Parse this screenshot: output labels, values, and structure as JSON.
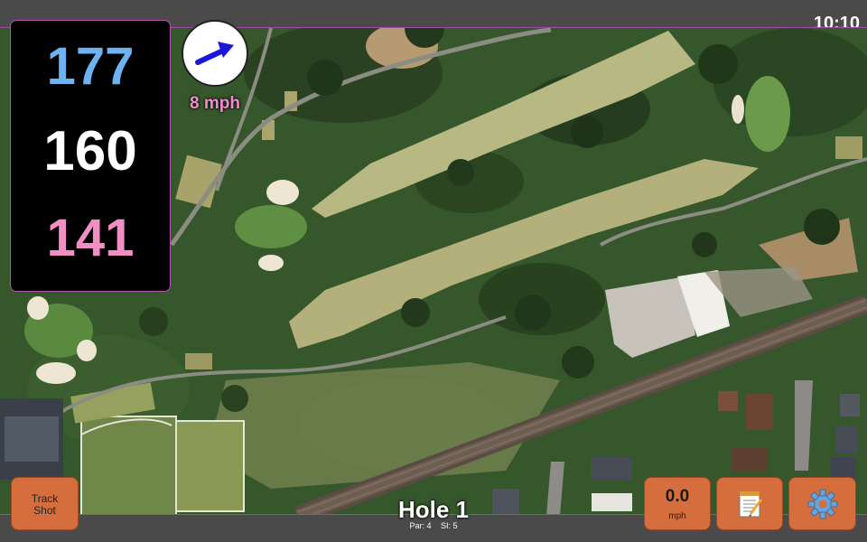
{
  "status": {
    "time": "10:10"
  },
  "distances": {
    "back": "177",
    "middle": "160",
    "front": "141"
  },
  "wind": {
    "speed": "8 mph",
    "direction_icon": "arrow-right-icon"
  },
  "hole": {
    "title": "Hole 1",
    "par": "Par: 4",
    "stroke_index": "SI: 5"
  },
  "buttons": {
    "track_shot_line1": "Track",
    "track_shot_line2": "Shot",
    "speed_value": "0.0",
    "speed_unit": "mph",
    "notes_icon": "notepad-icon",
    "settings_icon": "gear-icon"
  },
  "colors": {
    "back_distance": "#6eb2f2",
    "middle_distance": "#ffffff",
    "front_distance": "#f18ec4",
    "button": "#d56e3c",
    "bar": "#4a4a4a"
  }
}
